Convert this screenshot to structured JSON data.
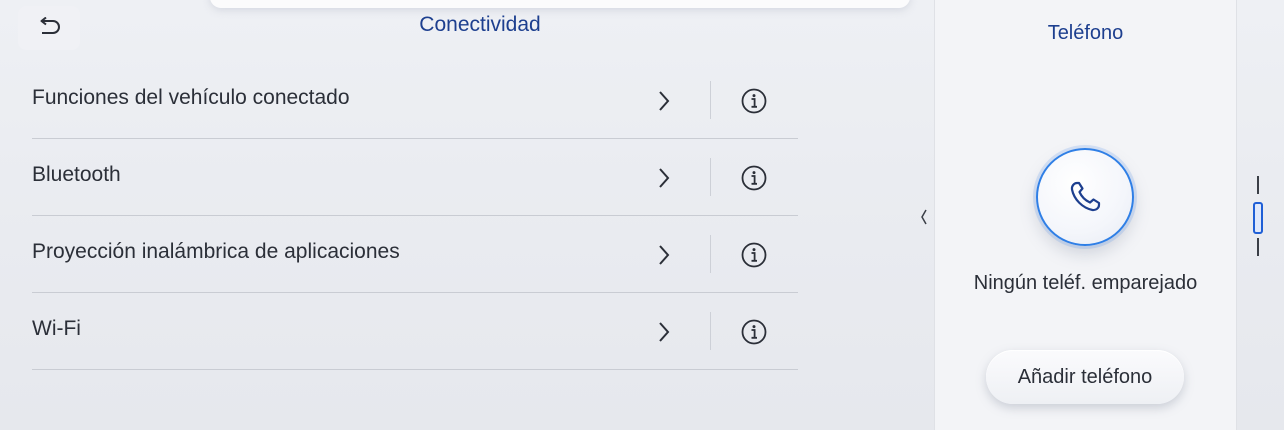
{
  "header": {
    "title": "Conectividad",
    "back_icon": "back-arrow-icon"
  },
  "settings": {
    "items": [
      {
        "label": "Funciones del vehículo conectado"
      },
      {
        "label": "Bluetooth"
      },
      {
        "label": "Proyección inalámbrica de aplicaciones"
      },
      {
        "label": "Wi-Fi"
      }
    ],
    "chevron_icon": "chevron-right-icon",
    "info_icon": "info-icon"
  },
  "phone_panel": {
    "title": "Teléfono",
    "icon": "phone-icon",
    "status": "Ningún teléf. emparejado",
    "add_button_label": "Añadir teléfono"
  },
  "colors": {
    "title_blue": "#1d3f8f",
    "accent_blue": "#2f7fe6",
    "text": "#2b2f38"
  }
}
